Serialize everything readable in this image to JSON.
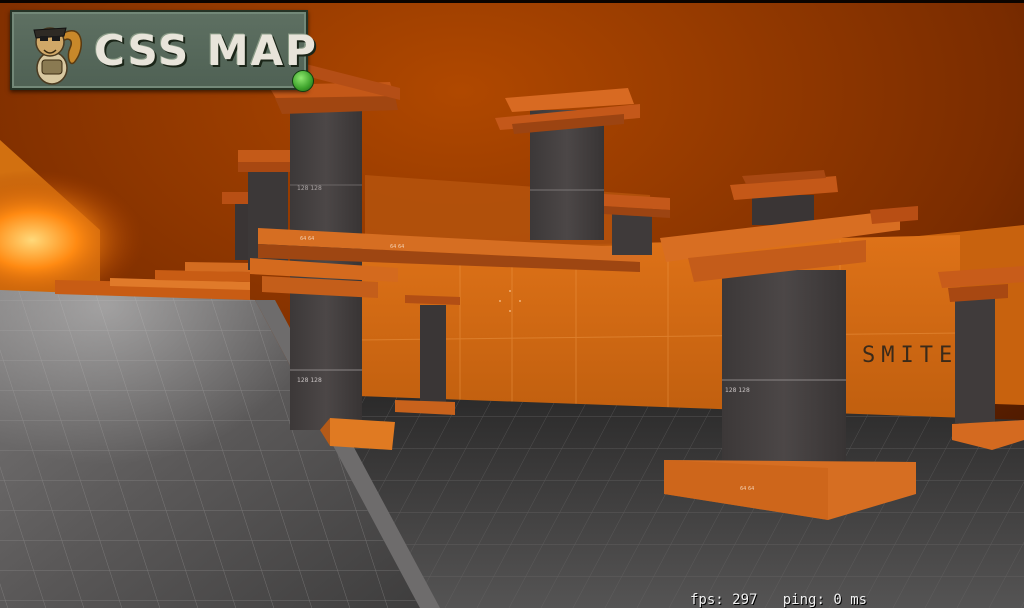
{
  "logo": {
    "text": "CSS MAP",
    "mascot_icon": "squirrel-mascot-icon"
  },
  "hud": {
    "fps_label": "fps:",
    "fps_value": "297",
    "ping_label": "ping:",
    "ping_value": "0 ms"
  },
  "scene": {
    "wall_sign": "SMITER",
    "texture_label": "128 128",
    "texture_label_small": "64 64",
    "colors": {
      "ceiling": "#a63f00",
      "wall_orange": "#d86a10",
      "pillar": "#4a4545",
      "floor": "#4c4b4b",
      "brick_trim": "#c8561a"
    }
  }
}
